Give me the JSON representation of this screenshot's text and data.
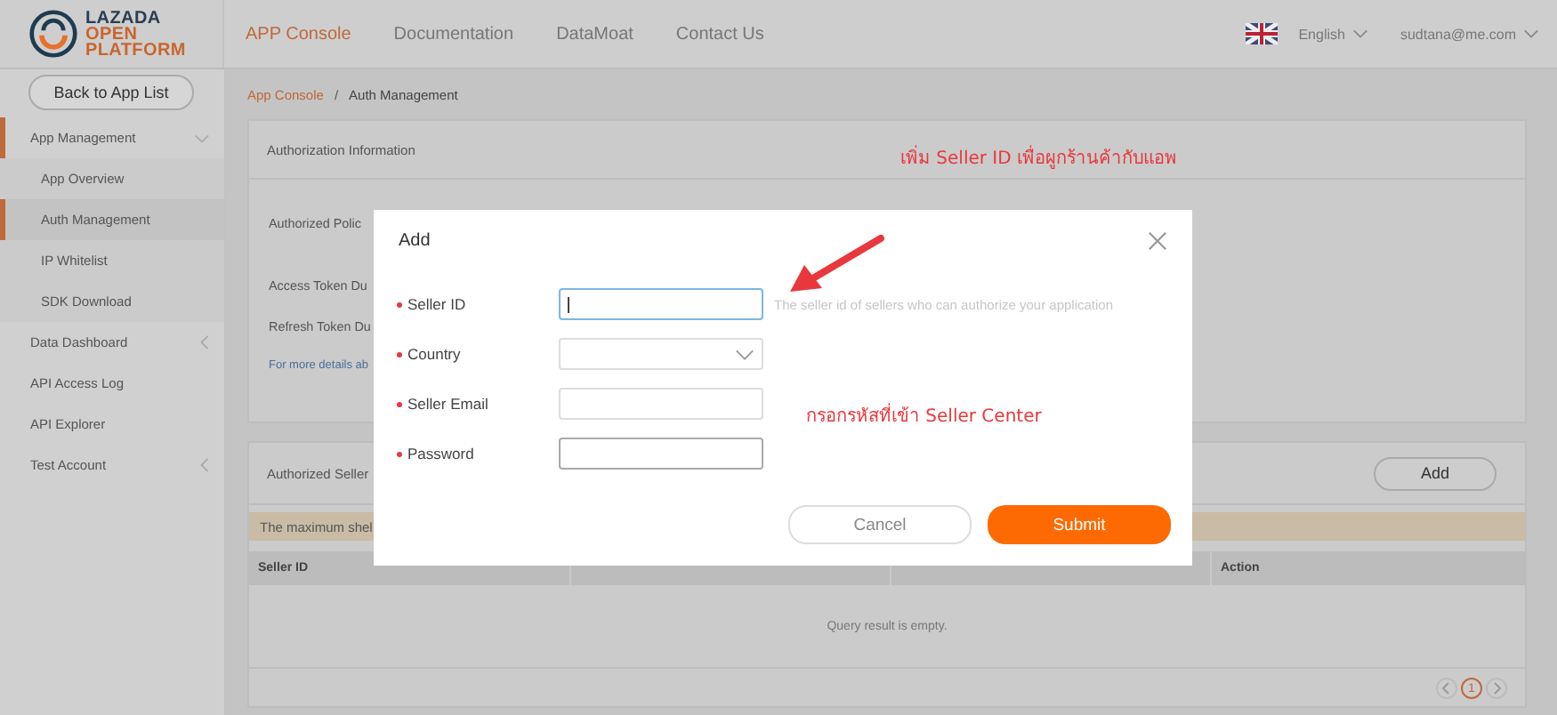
{
  "header": {
    "logo": [
      "LAZADA",
      "OPEN",
      "PLATFORM"
    ],
    "nav": [
      {
        "label": "APP Console",
        "selected": true
      },
      {
        "label": "Documentation",
        "selected": false
      },
      {
        "label": "DataMoat",
        "selected": false
      },
      {
        "label": "Contact Us",
        "selected": false
      }
    ],
    "language": "English",
    "user": "sudtana@me.com"
  },
  "sidebar": {
    "back_button": "Back to App List",
    "items": [
      {
        "label": "App Management",
        "selected": true,
        "expanded": true,
        "children": [
          {
            "label": "App Overview",
            "selected": false
          },
          {
            "label": "Auth Management",
            "selected": true
          },
          {
            "label": "IP Whitelist",
            "selected": false
          },
          {
            "label": "SDK Download",
            "selected": false
          }
        ]
      },
      {
        "label": "Data Dashboard",
        "selected": false,
        "expanded": false
      },
      {
        "label": "API Access Log",
        "selected": false
      },
      {
        "label": "API Explorer",
        "selected": false
      },
      {
        "label": "Test Account",
        "selected": false,
        "expanded": false
      }
    ]
  },
  "breadcrumb": {
    "separator": "/",
    "items": [
      "App Console",
      "Auth Management"
    ]
  },
  "auth_info": {
    "title": "Authorization Information",
    "rows": [
      "Authorized Polic",
      "Access Token Du",
      "Refresh Token Du"
    ],
    "link": "For more details ab"
  },
  "sellers": {
    "title": "Authorized Seller",
    "add_button": "Add",
    "notice": "The maximum shel",
    "table": {
      "columns": [
        {
          "label": "Seller ID"
        },
        {
          "covered": true
        },
        {
          "covered": true
        },
        {
          "label": "Action"
        }
      ],
      "empty_text": "Query result is empty."
    },
    "pagination": [
      {
        "label": "1",
        "selected": true
      }
    ]
  },
  "annotations": [
    {
      "kind": "title",
      "text": "เพิ่ม Seller ID เพื่อผูกร้านค้ากับแอพ"
    },
    {
      "kind": "note",
      "text": "กรอกรหัสที่เข้า Seller Center"
    }
  ],
  "modal": {
    "title": "Add",
    "fields": [
      {
        "label": "Seller ID",
        "kind": "text",
        "required": true,
        "focused": true,
        "hint": "The seller id of sellers who can authorize your application"
      },
      {
        "label": "Country",
        "kind": "select",
        "required": true,
        "focused": false
      },
      {
        "label": "Seller Email",
        "kind": "text",
        "required": true,
        "focused": false
      },
      {
        "label": "Password",
        "kind": "password",
        "required": true,
        "focused": false
      }
    ],
    "buttons": [
      {
        "label": "Cancel",
        "kind": "secondary"
      },
      {
        "label": "Submit",
        "kind": "primary"
      }
    ]
  }
}
